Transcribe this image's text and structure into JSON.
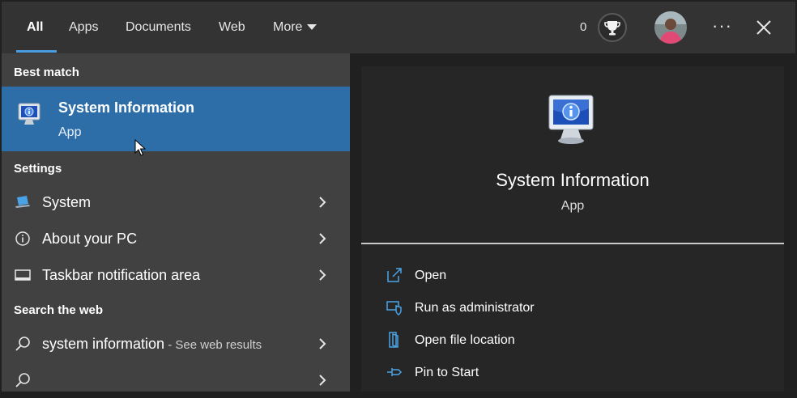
{
  "tabs": [
    {
      "label": "All",
      "active": true
    },
    {
      "label": "Apps"
    },
    {
      "label": "Documents"
    },
    {
      "label": "Web"
    },
    {
      "label": "More"
    }
  ],
  "header": {
    "reward_points": "0",
    "trophy_icon": "trophy-icon",
    "avatar_icon": "user-avatar",
    "more_options_icon": "ellipsis-icon",
    "close_icon": "close-icon"
  },
  "sections": {
    "best_match": "Best match",
    "settings": "Settings",
    "search_web": "Search the web"
  },
  "best_match": {
    "title": "System Information",
    "subtitle": "App",
    "icon": "system-information-icon"
  },
  "settings_items": [
    {
      "label": "System",
      "icon": "laptop-icon"
    },
    {
      "label": "About your PC",
      "icon": "info-circle-icon"
    },
    {
      "label": "Taskbar notification area",
      "icon": "taskbar-icon"
    }
  ],
  "web_items": [
    {
      "query": "system information",
      "hint": " - See web results",
      "icon": "search-icon"
    },
    {
      "query": "",
      "hint": "",
      "icon": "search-icon"
    }
  ],
  "preview": {
    "title": "System Information",
    "subtitle": "App",
    "icon": "system-information-icon"
  },
  "actions": [
    {
      "label": "Open",
      "icon": "open-icon"
    },
    {
      "label": "Run as administrator",
      "icon": "shield-icon"
    },
    {
      "label": "Open file location",
      "icon": "folder-icon"
    },
    {
      "label": "Pin to Start",
      "icon": "pin-icon"
    }
  ],
  "colors": {
    "accent": "#2d6ea9",
    "tab_underline": "#4a9de0",
    "left_pane": "#414141",
    "right_pane": "#262626",
    "topbar": "#333333"
  }
}
